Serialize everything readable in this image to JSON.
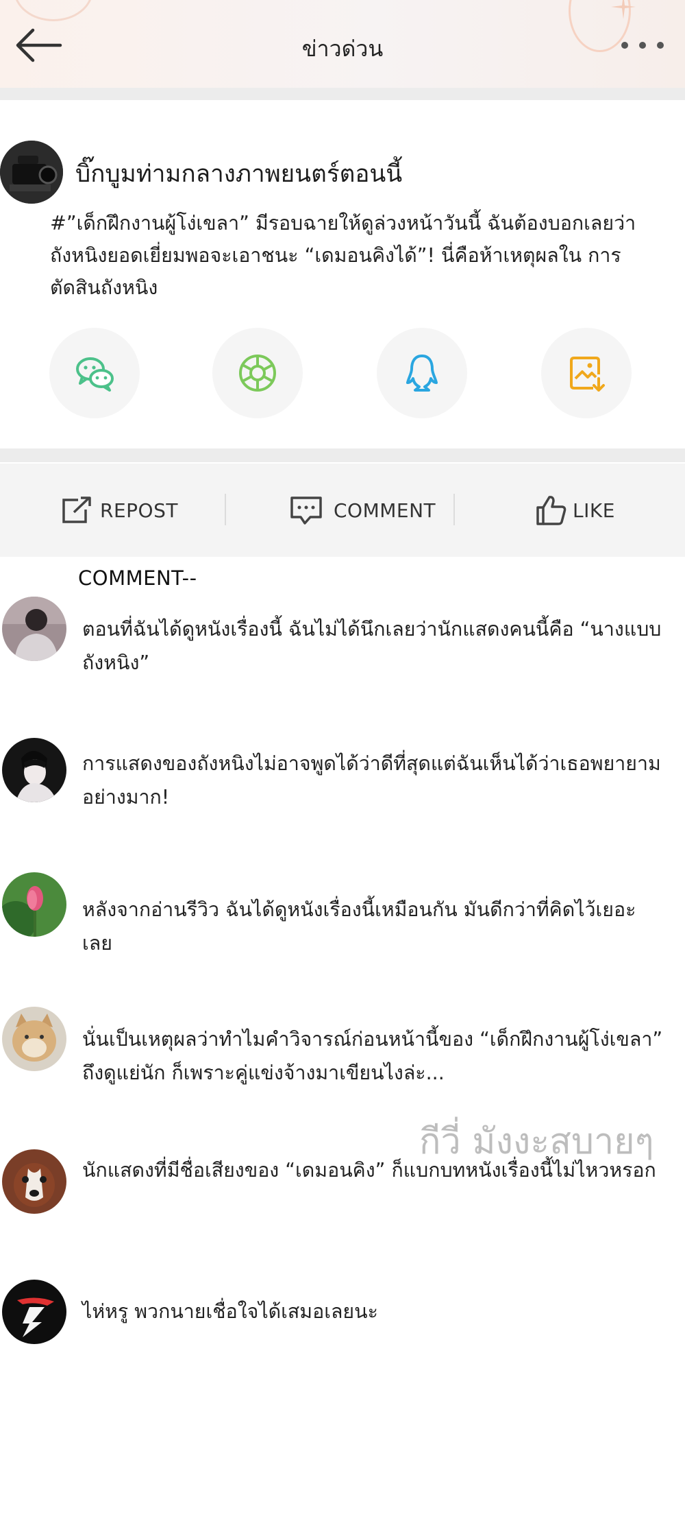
{
  "header": {
    "title": "ข่าวด่วน",
    "back_icon": "arrow-left-icon",
    "more_icon": "more-dots-icon"
  },
  "post": {
    "author": "บิ๊กบูมท่ามกลางภาพยนตร์ตอนนี้",
    "body": "#”เด็กฝึกงานผู้โง่เขลา” มีรอบฉายให้ดูล่วงหน้าวันนี้ ฉันต้องบอกเลยว่า ถังหนิงยอดเยี่ยมพอจะเอาชนะ “เดมอนคิงได้”! นี่คือห้าเหตุผลใน การตัดสินถังหนิง",
    "share_icons": [
      "wechat-icon",
      "moments-icon",
      "qq-icon",
      "save-image-icon"
    ]
  },
  "actions": {
    "repost": "REPOST",
    "comment": "COMMENT",
    "like": "LIKE"
  },
  "comments": {
    "heading": "COMMENT--",
    "items": [
      {
        "text": "ตอนที่ฉันได้ดูหนังเรื่องนี้ ฉันไม่ได้นึกเลยว่านักแสดงคนนี้คือ “นางแบบถังหนิง”"
      },
      {
        "text": "การแสดงของถังหนิงไม่อาจพูดได้ว่าดีที่สุดแต่ฉันเห็นได้ว่าเธอพยายาม อย่างมาก!"
      },
      {
        "text": "หลังจากอ่านรีวิว ฉันได้ดูหนังเรื่องนี้เหมือนกัน มันดีกว่าที่คิดไว้เยอะเลย"
      },
      {
        "text": "นั่นเป็นเหตุผลว่าทำไมคำวิจารณ์ก่อนหน้านี้ของ “เด็กฝึกงานผู้โง่เขลา” ถึงดูแย่นัก ก็เพราะคู่แข่งจ้างมาเขียนไงล่ะ..."
      },
      {
        "text": "นักแสดงที่มีชื่อเสียงของ “เดมอนคิง” ก็แบกบทหนังเรื่องนี้ไม่ไหวหรอก"
      },
      {
        "text": "ไห่หรู พวกนายเชื่อใจได้เสมอเลยนะ"
      }
    ]
  },
  "watermark": "กีวี่ มังงะสบายๆ",
  "colors": {
    "wechat": "#4cc18a",
    "moments": "#7cc95a",
    "qq": "#2aa6e0",
    "save": "#f0a81c"
  }
}
